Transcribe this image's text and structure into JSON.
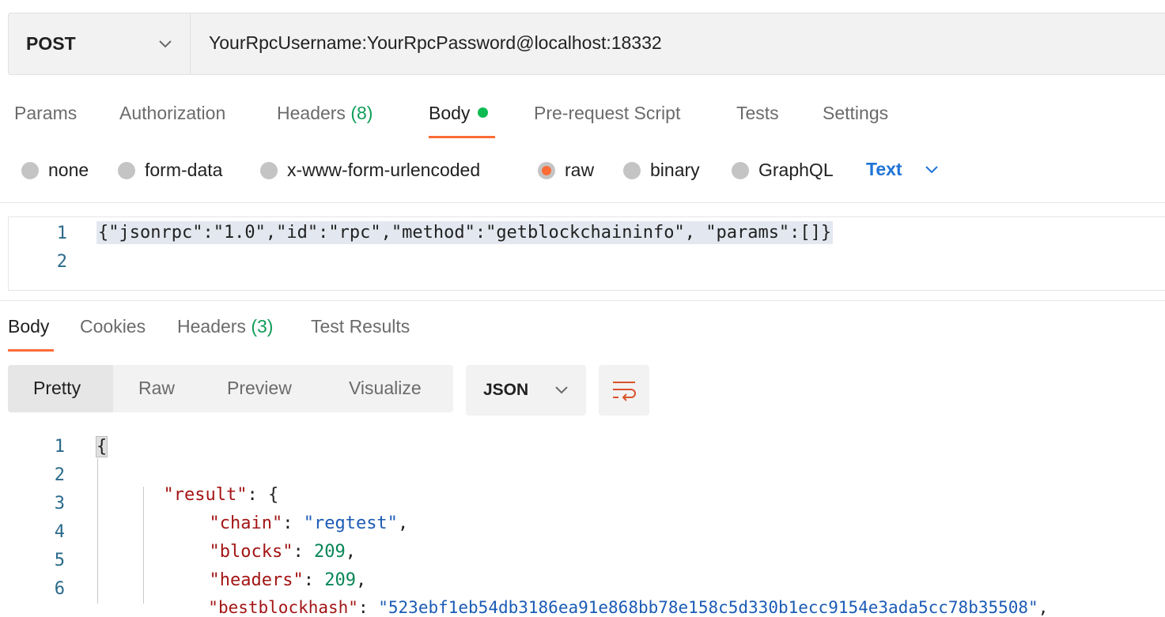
{
  "request": {
    "method": "POST",
    "url": "YourRpcUsername:YourRpcPassword@localhost:18332"
  },
  "request_tabs": {
    "params": "Params",
    "authorization": "Authorization",
    "headers": "Headers",
    "headers_count": "(8)",
    "body": "Body",
    "pre_request": "Pre-request Script",
    "tests": "Tests",
    "settings": "Settings"
  },
  "body_types": {
    "none": "none",
    "form_data": "form-data",
    "urlencoded": "x-www-form-urlencoded",
    "raw": "raw",
    "binary": "binary",
    "graphql": "GraphQL",
    "selected_format": "Text"
  },
  "request_body": {
    "line_numbers": [
      "1",
      "2"
    ],
    "line1": "{\"jsonrpc\":\"1.0\",\"id\":\"rpc\",\"method\":\"getblockchaininfo\", \"params\":[]}"
  },
  "response_tabs": {
    "body": "Body",
    "cookies": "Cookies",
    "headers": "Headers",
    "headers_count": "(3)",
    "test_results": "Test Results"
  },
  "view_modes": {
    "pretty": "Pretty",
    "raw": "Raw",
    "preview": "Preview",
    "visualize": "Visualize",
    "format": "JSON"
  },
  "response_body": {
    "line_numbers": [
      "1",
      "2",
      "3",
      "4",
      "5",
      "6"
    ],
    "open_brace": "{",
    "result_key": "\"result\"",
    "result_after": ": {",
    "chain_key": "\"chain\"",
    "chain_value": "\"regtest\"",
    "blocks_key": "\"blocks\"",
    "blocks_value": "209",
    "headers_key": "\"headers\"",
    "headers_value": "209",
    "bestblockhash_key": "\"bestblockhash\"",
    "bestblockhash_value": "\"523ebf1eb54db3186ea91e868bb78e158c5d330b1ecc9154e3ada5cc78b35508\""
  },
  "colors": {
    "accent": "#ff6c37",
    "success": "#0cbb52",
    "link_blue": "#1f74d6"
  }
}
